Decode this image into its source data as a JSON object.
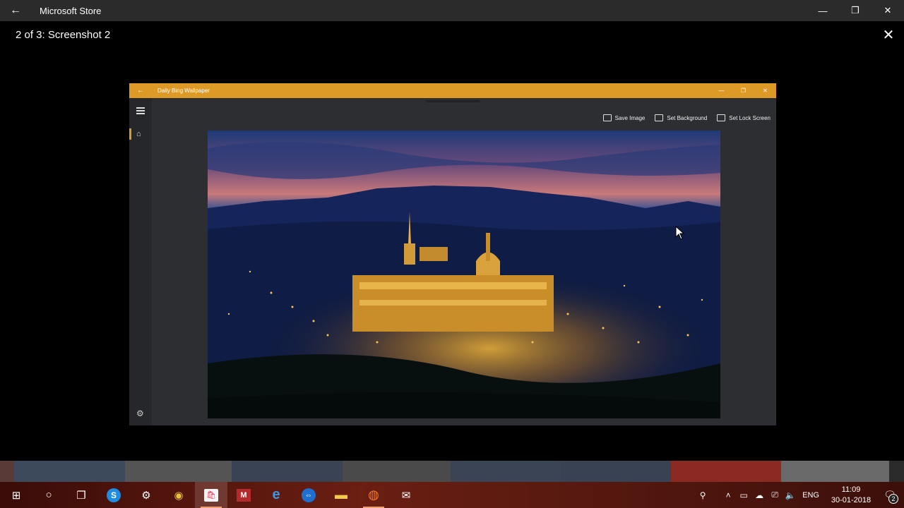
{
  "window": {
    "title": "Microsoft Store",
    "back_icon": "arrow-left-icon",
    "minimize_icon": "minimize-icon",
    "restore_icon": "restore-icon",
    "close_icon": "close-icon"
  },
  "viewer": {
    "title": "2 of 3: Screenshot 2",
    "close_icon": "close-icon"
  },
  "app_screenshot": {
    "title": "Daily Bing Wallpaper",
    "accent_color": "#dd9a26",
    "toolbar": {
      "save_image": "Save Image",
      "set_background": "Set Background",
      "set_lock_screen": "Set Lock Screen"
    },
    "nav_icons": [
      "hamburger-icon",
      "home-icon",
      "settings-icon"
    ]
  },
  "taskbar": {
    "apps": [
      {
        "name": "start-button",
        "icon": "windows-icon",
        "glyph": "⊞"
      },
      {
        "name": "cortana-button",
        "icon": "circle-icon",
        "glyph": "○"
      },
      {
        "name": "task-view-button",
        "icon": "task-view-icon",
        "glyph": "❐"
      },
      {
        "name": "skype-app",
        "icon": "skype-icon",
        "glyph": "S"
      },
      {
        "name": "settings-app",
        "icon": "gear-icon",
        "glyph": "⚙"
      },
      {
        "name": "chrome-app",
        "icon": "chrome-icon",
        "glyph": "◉"
      },
      {
        "name": "store-app",
        "icon": "store-icon",
        "glyph": "🛍"
      },
      {
        "name": "mendeley-app",
        "icon": "mendeley-icon",
        "glyph": "M"
      },
      {
        "name": "edge-app",
        "icon": "edge-icon",
        "glyph": "e"
      },
      {
        "name": "teamviewer-app",
        "icon": "teamviewer-icon",
        "glyph": "⇔"
      },
      {
        "name": "file-explorer-app",
        "icon": "folder-icon",
        "glyph": "▬"
      },
      {
        "name": "firefox-app",
        "icon": "firefox-icon",
        "glyph": "◍"
      },
      {
        "name": "mail-app",
        "icon": "mail-icon",
        "glyph": "✉"
      }
    ],
    "language": "ENG",
    "time": "11:09",
    "date": "30-01-2018",
    "notification_count": "2"
  }
}
